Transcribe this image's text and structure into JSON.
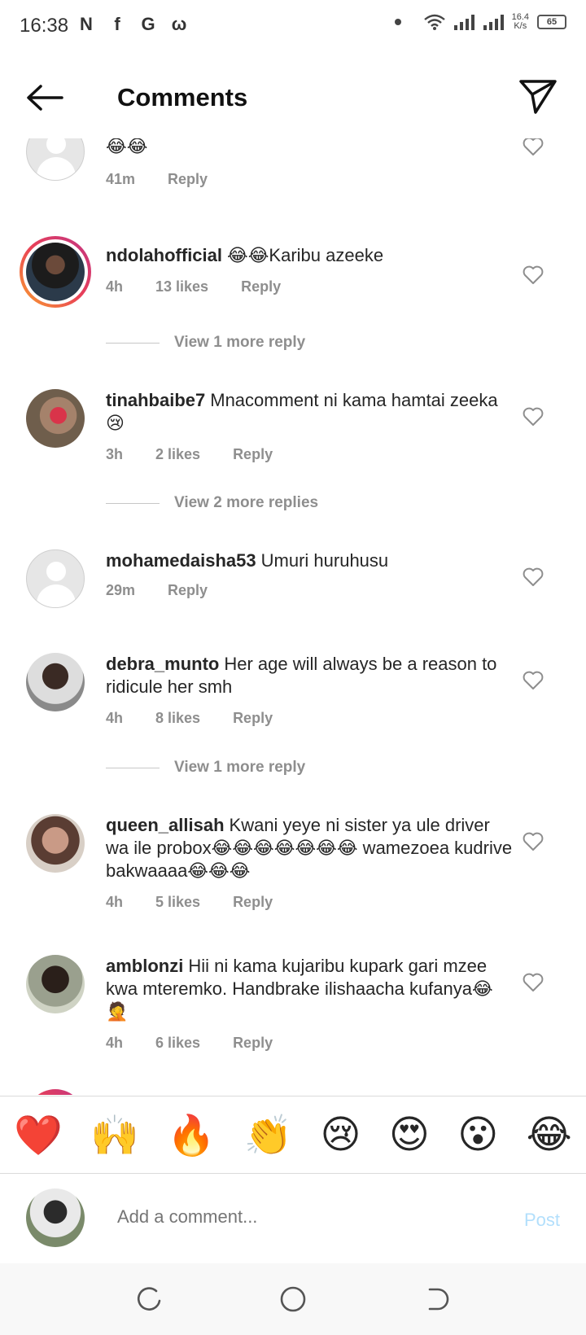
{
  "status_bar": {
    "time": "16:38",
    "app_icons": [
      "N",
      "f",
      "G",
      "ω"
    ],
    "speed_value": "16.4",
    "speed_unit": "K/s",
    "battery": "65"
  },
  "header": {
    "title": "Comments"
  },
  "comments": [
    {
      "username": "",
      "text": "😂😂",
      "time": "41m",
      "likes": "",
      "reply": "Reply",
      "avatar": "default"
    },
    {
      "username": "ndolahofficial",
      "text": "😂😂Karibu azeeke",
      "time": "4h",
      "likes": "13 likes",
      "reply": "Reply",
      "avatar": "story"
    },
    {
      "username": "tinahbaibe7",
      "text": "Mnacomment ni kama hamtai zeeka😢",
      "time": "3h",
      "likes": "2 likes",
      "reply": "Reply",
      "avatar": "photo"
    },
    {
      "username": "mohamedaisha53",
      "text": "Umuri huruhusu",
      "time": "29m",
      "likes": "",
      "reply": "Reply",
      "avatar": "default"
    },
    {
      "username": "debra_munto",
      "text": "Her age will always be a reason to ridicule her smh",
      "time": "4h",
      "likes": "8 likes",
      "reply": "Reply",
      "avatar": "photo"
    },
    {
      "username": "queen_allisah",
      "text": "Kwani yeye ni sister ya ule driver wa ile probox😂😂😂😂😂😂😂 wamezoea kudrive bakwaaaa😂😂😂",
      "time": "4h",
      "likes": "5 likes",
      "reply": "Reply",
      "avatar": "photo"
    },
    {
      "username": "amblonzi",
      "text": "Hii ni kama kujaribu kupark gari mzee kwa mteremko. Handbrake ilishaacha kufanya😂🤦",
      "time": "4h",
      "likes": "6 likes",
      "reply": "Reply",
      "avatar": "photo"
    }
  ],
  "view_replies": [
    "View 1 more reply",
    "View 2 more replies",
    "View 1 more reply"
  ],
  "emoji_bar": [
    "❤️",
    "🙌",
    "🔥",
    "👏",
    "😢",
    "😍",
    "😮",
    "😂"
  ],
  "composer": {
    "placeholder": "Add a comment...",
    "post_label": "Post"
  },
  "colors": {
    "text": "#262626",
    "meta": "#8e8e8e",
    "post_disabled": "#b2dffc",
    "story_ring_start": "#f9a12e",
    "story_ring_end": "#c13584"
  }
}
